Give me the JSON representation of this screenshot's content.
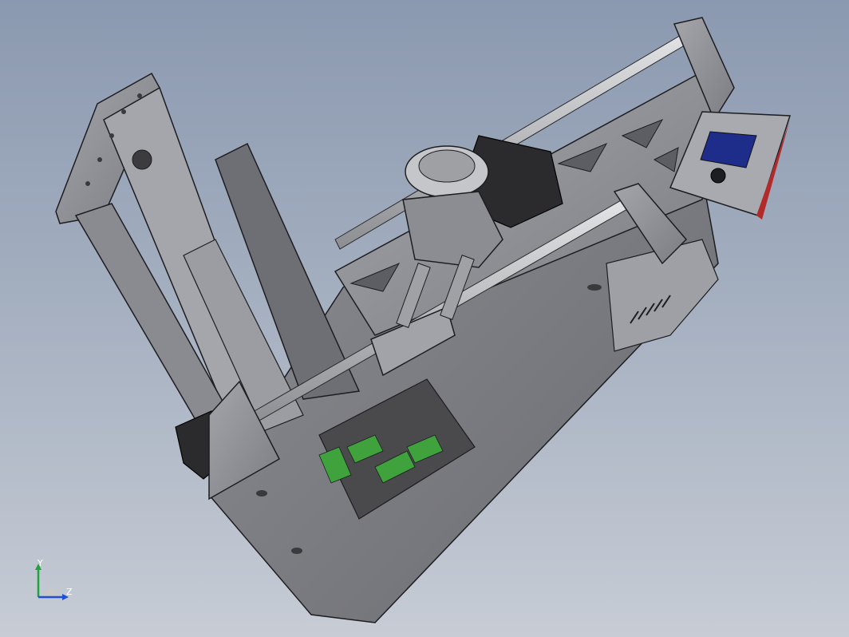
{
  "viewport": {
    "background_top": "#8b99b0",
    "background_bottom": "#c7ccd5",
    "subject": "3d-printer-cad-assembly"
  },
  "colors": {
    "frame_metal": "#8f9095",
    "frame_metal_light": "#b3b4b9",
    "frame_metal_dark": "#5d5e63",
    "edge": "#1d1d20",
    "rod": "#c9cacd",
    "motor": "#2b2b2e",
    "pcb_green": "#3fa23c",
    "pcb_dark": "#3d3d3f",
    "lcd_blue": "#1f2d8a",
    "accent_red": "#b22a2a",
    "axis_y": "#1fa33a",
    "axis_z": "#1f4fd8",
    "axis_x": "#c8c8c8"
  },
  "triad": {
    "y_label": "Y",
    "z_label": "Z",
    "icon": "coordinate-triad-icon"
  }
}
